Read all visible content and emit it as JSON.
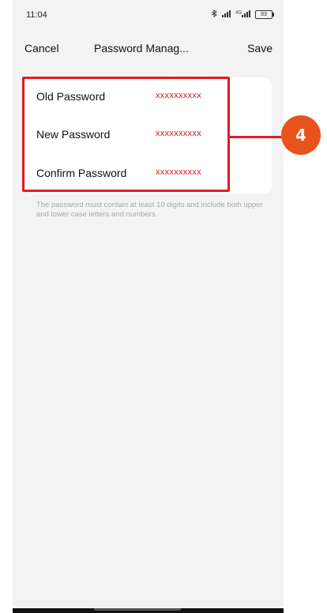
{
  "status": {
    "time": "11:04",
    "signal": "4G",
    "battery": "83"
  },
  "nav": {
    "cancel": "Cancel",
    "title": "Password Manag...",
    "save": "Save"
  },
  "fields": [
    {
      "label": "Old Password",
      "value": "xxxxxxxxxx"
    },
    {
      "label": "New Password",
      "value": "xxxxxxxxxx"
    },
    {
      "label": "Confirm Password",
      "value": "xxxxxxxxxx"
    }
  ],
  "hint": "The password must contain at least 10 digits and include both upper and lower case letters and numbers.",
  "callout": {
    "number": "4"
  },
  "colors": {
    "accent": "#e31b23",
    "callout": "#e8531c",
    "value_text": "#d9141c",
    "background": "#f3f3f3"
  },
  "icons": [
    "bluetooth-icon",
    "signal-icon",
    "4g-signal-icon",
    "battery-icon"
  ]
}
